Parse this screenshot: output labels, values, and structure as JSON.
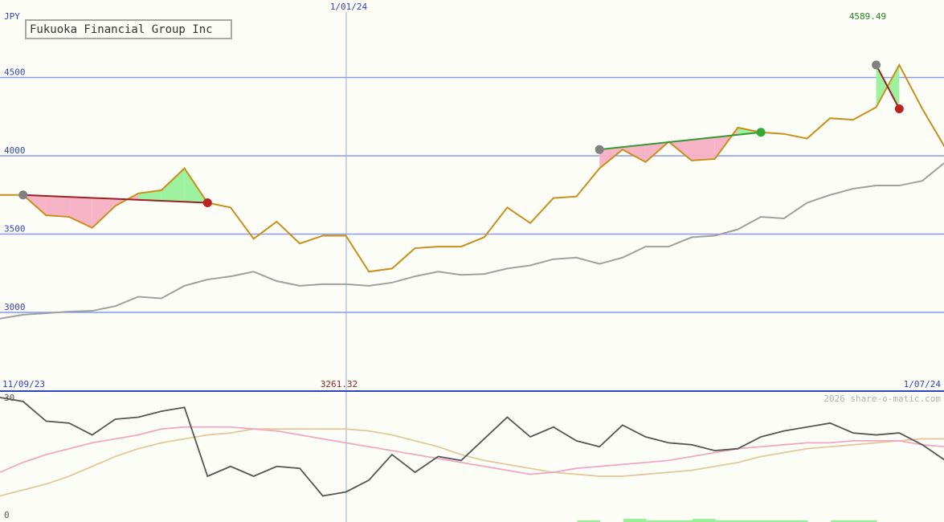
{
  "header": {
    "company": "Fukuoka Financial Group Inc",
    "currency": "JPY",
    "watermark": "2026 share-o-matic.com"
  },
  "colors": {
    "background": "#fdfdf8",
    "price": "#c8901a",
    "average": "#a0a0a0",
    "gridline": "#8899ee",
    "axis_text": "#3344bb",
    "high_text": "#228822",
    "low_text": "#992222",
    "buy_fill": "#99f099",
    "sell_fill": "#f7b0c4",
    "buy_trend": "#339933",
    "sell_trend": "#992222",
    "marker_grey": "#808080",
    "marker_red": "#bb2222",
    "marker_green": "#33aa33",
    "osc_dark": "#555555",
    "osc_pink": "#f0a8c0",
    "osc_tan": "#e2c89a",
    "divider": "#3344bb"
  },
  "chart_data": [
    {
      "type": "line",
      "title": "Fukuoka Financial Group Inc",
      "ylabel": "JPY",
      "ylim": [
        2950,
        4700
      ],
      "ticks": [
        3000,
        3500,
        4000,
        4500
      ],
      "tick_labels": [
        "3000",
        "3500",
        "4000",
        "4500"
      ],
      "date_labels": {
        "start": "11/09/23",
        "marker": "1/01/24",
        "end": "1/07/24"
      },
      "high": {
        "label": "4589.49",
        "value": 4589.49
      },
      "low": {
        "label": "3261.32",
        "value": 3261.32
      },
      "x": [
        0,
        1,
        2,
        3,
        4,
        5,
        6,
        7,
        8,
        9,
        10,
        11,
        12,
        13,
        14,
        15,
        16,
        17,
        18,
        19,
        20,
        21,
        22,
        23,
        24,
        25,
        26,
        27,
        28,
        29,
        30,
        31,
        32,
        33,
        34,
        35,
        36,
        37,
        38,
        39,
        40,
        41
      ],
      "series": [
        {
          "role": "price",
          "values": [
            3750,
            3750,
            3620,
            3610,
            3540,
            3680,
            3760,
            3780,
            3920,
            3700,
            3670,
            3470,
            3580,
            3440,
            3490,
            3490,
            3260,
            3280,
            3410,
            3420,
            3420,
            3480,
            3670,
            3570,
            3730,
            3740,
            3920,
            4040,
            3960,
            4090,
            3970,
            3980,
            4180,
            4150,
            4140,
            4110,
            4240,
            4230,
            4310,
            4580,
            4300,
            4050
          ]
        },
        {
          "role": "average",
          "values": [
            2960,
            2985,
            2995,
            3005,
            3010,
            3040,
            3100,
            3090,
            3170,
            3210,
            3230,
            3260,
            3200,
            3170,
            3180,
            3180,
            3170,
            3190,
            3230,
            3260,
            3240,
            3245,
            3280,
            3300,
            3340,
            3350,
            3310,
            3350,
            3420,
            3420,
            3480,
            3490,
            3530,
            3610,
            3600,
            3700,
            3750,
            3790,
            3810,
            3810,
            3840,
            3960
          ]
        }
      ],
      "signals": [
        {
          "kind": "sell",
          "start_index": 1,
          "start_value": 3750,
          "end_index": 9,
          "end_value": 3700
        },
        {
          "kind": "buy",
          "start_index": 26,
          "start_value": 4040,
          "end_index": 33,
          "end_value": 4150
        },
        {
          "kind": "sell",
          "start_index": 38,
          "start_value": 4580,
          "end_index": 39,
          "end_value": 4300
        }
      ]
    },
    {
      "type": "line",
      "ylim": [
        0,
        30
      ],
      "tick_labels": [
        "30",
        "0"
      ],
      "x": [
        0,
        1,
        2,
        3,
        4,
        5,
        6,
        7,
        8,
        9,
        10,
        11,
        12,
        13,
        14,
        15,
        16,
        17,
        18,
        19,
        20,
        21,
        22,
        23,
        24,
        25,
        26,
        27,
        28,
        29,
        30,
        31,
        32,
        33,
        34,
        35,
        36,
        37,
        38,
        39,
        40,
        41
      ],
      "series": [
        {
          "role": "oscillator",
          "values": [
            30,
            29,
            24,
            23.5,
            20.5,
            24.5,
            25,
            26.5,
            27.5,
            10,
            12.5,
            10,
            12.5,
            12,
            5,
            6,
            9,
            15.5,
            11,
            15,
            14,
            19.5,
            25,
            20,
            22.5,
            19,
            17.5,
            23,
            20,
            18.5,
            18,
            16.5,
            17,
            20,
            21.5,
            22.5,
            23.5,
            21,
            20.5,
            21,
            18,
            14
          ]
        },
        {
          "role": "fast_average",
          "values": [
            11,
            13.5,
            15.5,
            17,
            18.5,
            19.5,
            20.5,
            22,
            22.5,
            22.5,
            22.5,
            22,
            21.5,
            20.5,
            19.5,
            18.5,
            17.5,
            16.5,
            15.5,
            14.5,
            13.5,
            12.5,
            11.5,
            10.5,
            11,
            12,
            12.5,
            13,
            13.5,
            14,
            15,
            16,
            17,
            17.5,
            18,
            18.5,
            18.5,
            19,
            19,
            19,
            18,
            17.5
          ]
        },
        {
          "role": "slow_average",
          "values": [
            5,
            6.5,
            8,
            10,
            12.5,
            15,
            17,
            18.5,
            19.5,
            20.5,
            21,
            22,
            22,
            22,
            22,
            22,
            21.5,
            20.5,
            19,
            17.5,
            15.5,
            14,
            13,
            12,
            11,
            10.5,
            10,
            10,
            10.5,
            11,
            11.5,
            12.5,
            13.5,
            15,
            16,
            17,
            17.5,
            18,
            18.5,
            19,
            19.5,
            19.5
          ]
        }
      ],
      "volume_bars": [
        {
          "start_index": 25,
          "end_index": 26,
          "level": 1
        },
        {
          "start_index": 27,
          "end_index": 28,
          "level": 1.8
        },
        {
          "start_index": 28,
          "end_index": 30,
          "level": 1
        },
        {
          "start_index": 30,
          "end_index": 31,
          "level": 1.8
        },
        {
          "start_index": 31,
          "end_index": 35,
          "level": 1
        },
        {
          "start_index": 36,
          "end_index": 38,
          "level": 1
        }
      ]
    }
  ]
}
